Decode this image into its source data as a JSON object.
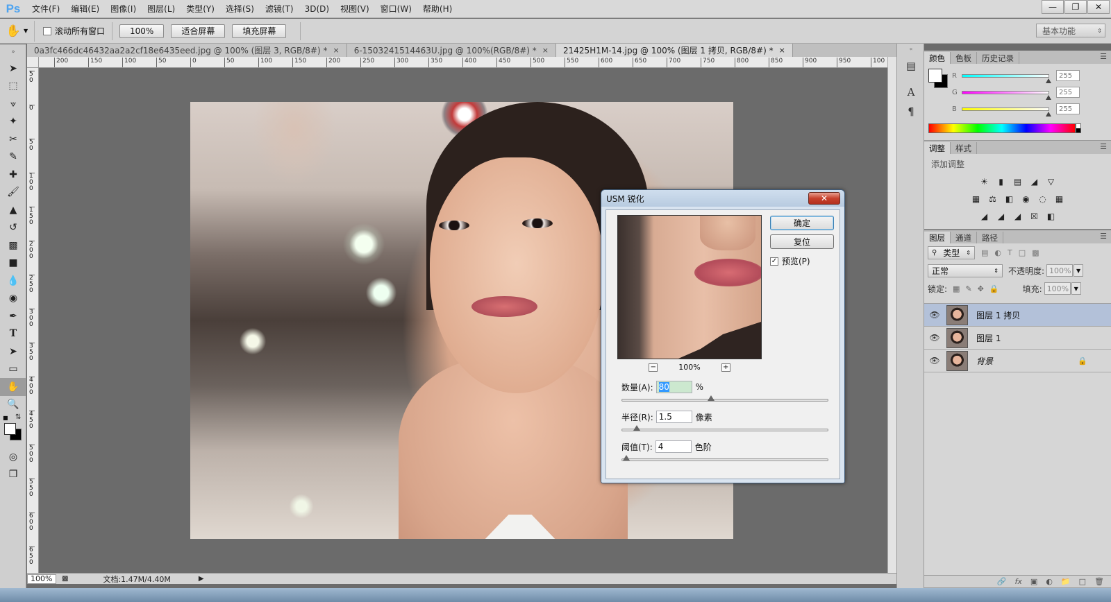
{
  "app": {
    "logo": "Ps",
    "menu": [
      "文件(F)",
      "编辑(E)",
      "图像(I)",
      "图层(L)",
      "类型(Y)",
      "选择(S)",
      "滤镜(T)",
      "3D(D)",
      "视图(V)",
      "窗口(W)",
      "帮助(H)"
    ],
    "window_buttons": [
      "minimize-icon",
      "restore-icon",
      "close-icon"
    ]
  },
  "options": {
    "scroll_all_label": "滚动所有窗口",
    "zoom_btn": "100%",
    "fit_screen_btn": "适合屏幕",
    "fill_screen_btn": "填充屏幕",
    "workspace": "基本功能"
  },
  "tabs": [
    {
      "label": "0a3fc466dc46432aa2a2cf18e6435eed.jpg @ 100% (图层 3, RGB/8#) *",
      "active": false
    },
    {
      "label": "6-1503241514463U.jpg @ 100%(RGB/8#) *",
      "active": false
    },
    {
      "label": "21425H1M-14.jpg @ 100% (图层 1 拷贝, RGB/8#) *",
      "active": true
    }
  ],
  "ruler_h_labels": [
    "200",
    "150",
    "100",
    "50",
    "0",
    "50",
    "100",
    "150",
    "200",
    "250",
    "300",
    "350",
    "400",
    "450",
    "500",
    "550",
    "600",
    "650",
    "700",
    "750",
    "800",
    "850",
    "900",
    "950",
    "100"
  ],
  "ruler_v_labels": [
    "5 0",
    "0",
    "5 0",
    "1 0 0",
    "1 5 0",
    "2 0 0",
    "2 5 0",
    "3 0 0",
    "3 5 0",
    "4 0 0",
    "4 5 0",
    "5 0 0",
    "5 5 0",
    "6 0 0",
    "6 5 0"
  ],
  "status": {
    "zoom": "100%",
    "doc": "文档:1.47M/4.40M"
  },
  "color_panel": {
    "tabs": [
      "颜色",
      "色板",
      "历史记录"
    ],
    "channels": [
      {
        "label": "R",
        "value": "255",
        "color": "#00ffff"
      },
      {
        "label": "G",
        "value": "255",
        "color": "#ff00ff"
      },
      {
        "label": "B",
        "value": "255",
        "color": "#ffff00"
      }
    ]
  },
  "adjust_panel": {
    "tabs": [
      "调整",
      "样式"
    ],
    "title": "添加调整"
  },
  "layers_panel": {
    "tabs": [
      "图层",
      "通道",
      "路径"
    ],
    "filter": "类型",
    "blend_mode": "正常",
    "opacity_label": "不透明度:",
    "opacity_value": "100%",
    "lock_label": "锁定:",
    "fill_label": "填充:",
    "fill_value": "100%",
    "layers": [
      {
        "name": "图层 1 拷贝",
        "selected": true,
        "locked": false
      },
      {
        "name": "图层 1",
        "selected": false,
        "locked": false
      },
      {
        "name": "背景",
        "selected": false,
        "locked": true
      }
    ]
  },
  "dialog": {
    "title": "USM 锐化",
    "ok": "确定",
    "reset": "复位",
    "preview_label": "预览(P)",
    "preview_checked": true,
    "preview_zoom": "100%",
    "amount": {
      "label": "数量(A):",
      "value": "80",
      "unit": "%",
      "slider_fraction": 0.43
    },
    "radius": {
      "label": "半径(R):",
      "value": "1.5",
      "unit": "像素",
      "slider_fraction": 0.07
    },
    "threshold": {
      "label": "阈值(T):",
      "value": "4",
      "unit": "色阶",
      "slider_fraction": 0.02
    }
  }
}
